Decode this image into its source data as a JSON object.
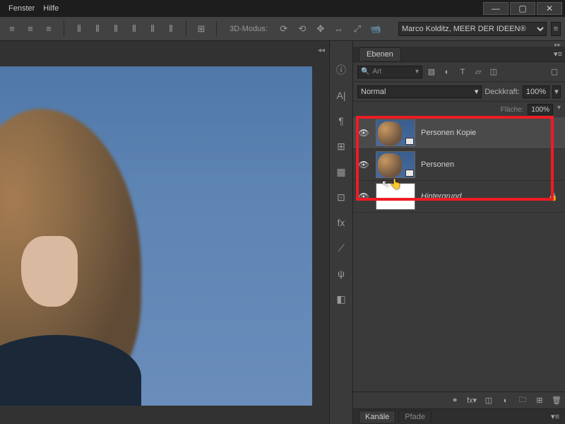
{
  "menu": {
    "window": "Fenster",
    "help": "Hilfe"
  },
  "wincontrols": {
    "min": "—",
    "max": "▢",
    "close": "✕"
  },
  "ribbon": {
    "mode3d_label": "3D-Modus:",
    "promo_text": "Marco Kolditz, MEER DER IDEEN®"
  },
  "panel": {
    "tab_layers": "Ebenen",
    "search_label": "Art",
    "blend_mode": "Normal",
    "opacity_label": "Deckkraft:",
    "opacity_value": "100%",
    "fill_label": "Fläche:",
    "fill_value": "100%"
  },
  "layers": [
    {
      "name": "Personen Kopie",
      "visible": true,
      "selected": true,
      "smart": true,
      "thumb": "people"
    },
    {
      "name": "Personen",
      "visible": true,
      "selected": false,
      "smart": true,
      "thumb": "people"
    },
    {
      "name": "Hintergrund",
      "visible": true,
      "selected": false,
      "smart": false,
      "thumb": "white",
      "locked": true
    }
  ],
  "bottom_tabs": {
    "channels": "Kanäle",
    "paths": "Pfade"
  }
}
